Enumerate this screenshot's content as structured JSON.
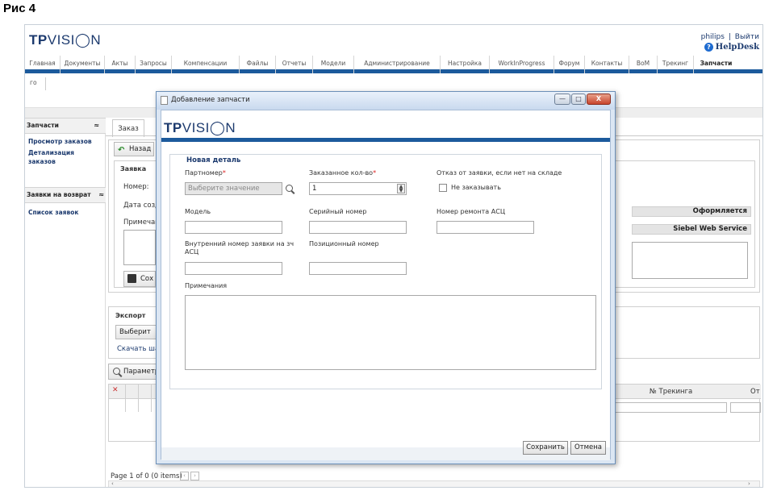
{
  "figure_caption": "Рис 4",
  "brand": {
    "logo_bold": "TP",
    "logo_rest": "VISI◯N"
  },
  "user": {
    "name": "philips",
    "separator": "|",
    "logout": "Выйти",
    "helpdesk": "HelpDesk"
  },
  "nav": [
    {
      "label": "Главная"
    },
    {
      "label": "Документы"
    },
    {
      "label": "Акты"
    },
    {
      "label": "Запросы"
    },
    {
      "label": "Компенсации"
    },
    {
      "label": "Файлы"
    },
    {
      "label": "Отчеты"
    },
    {
      "label": "Модели"
    },
    {
      "label": "Администрирование"
    },
    {
      "label": "Настройка"
    },
    {
      "label": "WorkInProgress"
    },
    {
      "label": "Форум"
    },
    {
      "label": "Контакты"
    },
    {
      "label": "BoM"
    },
    {
      "label": "Трекинг"
    },
    {
      "label": "Запчасти"
    }
  ],
  "subtab": "го",
  "sidebar": {
    "section1": {
      "title": "Запчасти",
      "links": [
        "Просмотр заказов",
        "Детализация заказов"
      ]
    },
    "section2": {
      "title": "Заявки на возврат",
      "links": [
        "Список заявок"
      ]
    }
  },
  "main": {
    "tab": "Заказ",
    "back_button": "Назад",
    "request_section": "Заявка",
    "number_label": "Номер:",
    "date_label": "Дата созд",
    "note_label": "Примечан",
    "save_button_partial": "Сох",
    "status1": "Оформляется",
    "status2": "Siebel Web Service",
    "export_section": "Экспорт",
    "export_select": "Выберит",
    "download_link": "Скачать ша",
    "params_button": "Параметр",
    "col_tracking": "№ Трекинга",
    "col_partial": "От",
    "pager": "Page 1 of 0 (0 items)"
  },
  "modal": {
    "title": "Добавление запчасти",
    "win_minimize": "—",
    "win_maximize": "□",
    "win_close": "X",
    "group_title": "Новая деталь",
    "partnumber_label": "Партномер",
    "partnumber_placeholder": "Выберите значение",
    "qty_label": "Заказанное кол-во",
    "qty_value": "1",
    "refuse_label": "Отказ от заявки, если нет на складе",
    "no_order_label": "Не заказывать",
    "model_label": "Модель",
    "serial_label": "Серийный номер",
    "repair_label": "Номер ремонта АСЦ",
    "internal_label_line1": "Внутренний номер заявки на зч",
    "internal_label_line2": "АСЦ",
    "position_label": "Позиционный номер",
    "notes_label": "Примечания",
    "required_mark": "*",
    "save_button": "Сохранить",
    "cancel_button": "Отмена"
  }
}
